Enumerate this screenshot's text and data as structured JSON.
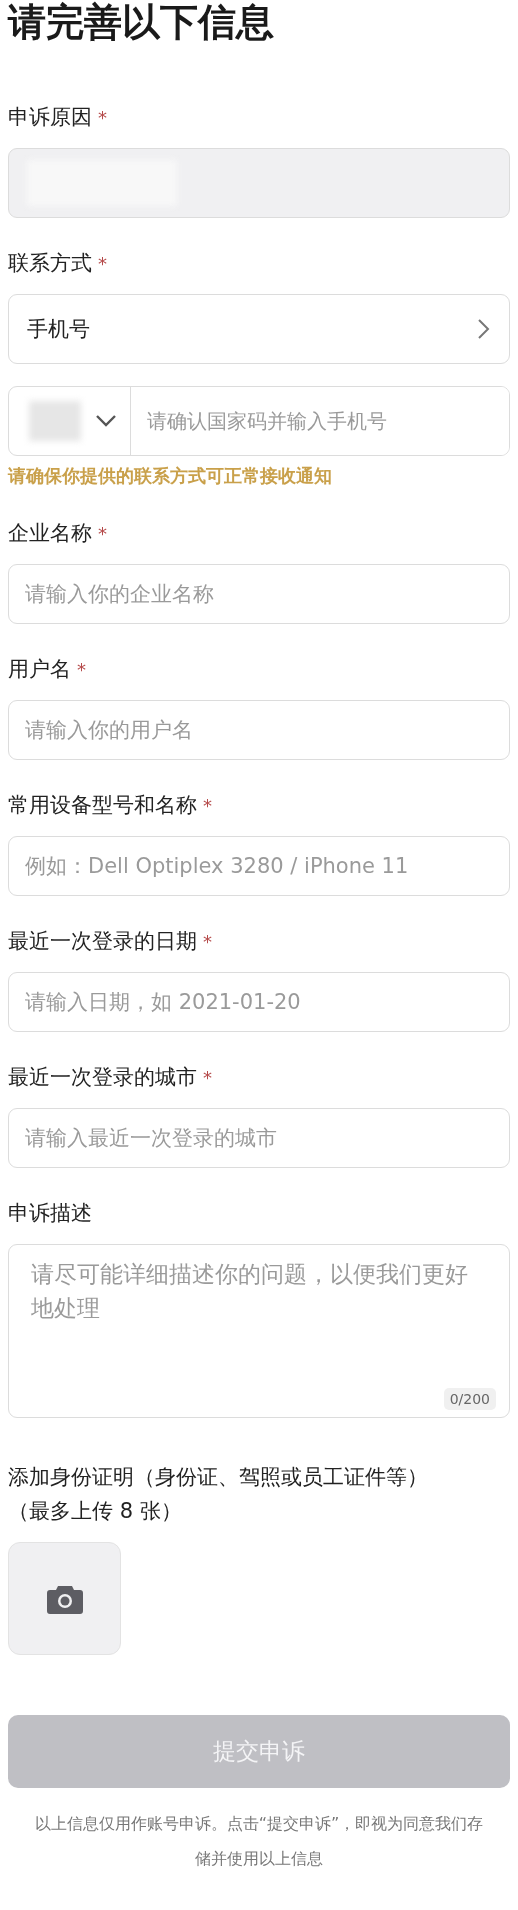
{
  "title": "请完善以下信息",
  "fields": [
    {
      "kind": "readonly",
      "label": "申诉原因",
      "required_mark": "*",
      "disabled": true
    },
    {
      "kind": "select",
      "label": "联系方式",
      "required_mark": "*",
      "value": "手机号"
    },
    {
      "kind": "phone",
      "placeholder": "请确认国家码并输入手机号",
      "hint": "请确保你提供的联系方式可正常接收通知"
    },
    {
      "kind": "text",
      "label": "企业名称",
      "required_mark": "*",
      "placeholder": "请输入你的企业名称"
    },
    {
      "kind": "text",
      "label": "用户名",
      "required_mark": "*",
      "placeholder": "请输入你的用户名"
    },
    {
      "kind": "text",
      "label": "常用设备型号和名称",
      "required_mark": "*",
      "placeholder": "例如：Dell Optiplex 3280 / iPhone 11"
    },
    {
      "kind": "text",
      "label": "最近一次登录的日期",
      "required_mark": "*",
      "placeholder": "请输入日期，如 2021-01-20"
    },
    {
      "kind": "text",
      "label": "最近一次登录的城市",
      "required_mark": "*",
      "placeholder": "请输入最近一次登录的城市"
    },
    {
      "kind": "textarea",
      "label": "申诉描述",
      "placeholder": "请尽可能详细描述你的问题，以便我们更好地处理",
      "counter": "0/200"
    },
    {
      "kind": "upload",
      "label": "添加身份证明（身份证、驾照或员工证件等）",
      "sublabel": "（最多上传 8 张）"
    }
  ],
  "submit": {
    "label": "提交申诉",
    "disabled": true
  },
  "footer": "以上信息仅用作账号申诉。点击“提交申诉”，即视为同意我们存储并使用以上信息"
}
